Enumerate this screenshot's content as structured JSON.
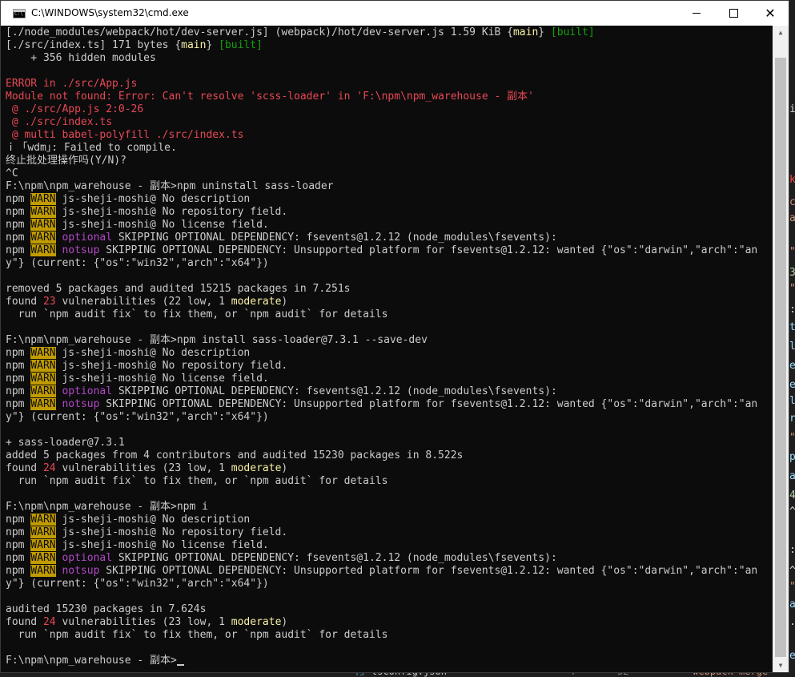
{
  "window": {
    "title": "C:\\WINDOWS\\system32\\cmd.exe",
    "minimize": "minimize",
    "maximize": "maximize",
    "close": "✕"
  },
  "background": {
    "right_chars": [
      "i",
      "k",
      "c",
      "a",
      "\"",
      "3",
      "\"",
      ":",
      "t",
      "l",
      "e",
      "e",
      "l",
      "r",
      "\"",
      "p",
      "a",
      "4",
      "^",
      ":",
      "^",
      "\"",
      "a",
      ".",
      "e"
    ],
    "bottom_ts": "TS",
    "bottom_file": "tsconfig.json",
    "bottom_num1": "7",
    "bottom_num2": "32",
    "bottom_code": "\"webpack-merge\""
  },
  "console_lines": [
    [
      {
        "t": "[./node_modules/webpack/hot/dev-server.js] (webpack)/hot/dev-server.js 1.59 KiB {"
      },
      {
        "t": "main",
        "c": "yellow"
      },
      {
        "t": "} "
      },
      {
        "t": "[built]",
        "c": "green"
      }
    ],
    [
      {
        "t": "[./src/index.ts] 171 bytes {"
      },
      {
        "t": "main",
        "c": "yellow"
      },
      {
        "t": "} "
      },
      {
        "t": "[built]",
        "c": "green"
      }
    ],
    [
      {
        "t": "    + 356 hidden modules"
      }
    ],
    [
      {
        "t": ""
      }
    ],
    [
      {
        "t": "ERROR in ./src/App.js",
        "c": "red"
      }
    ],
    [
      {
        "t": "Module not found: Error: Can't resolve 'scss-loader' in 'F:\\npm\\npm_warehouse - 副本'",
        "c": "red"
      }
    ],
    [
      {
        "t": " @ ./src/App.js 2:0-26",
        "c": "red"
      }
    ],
    [
      {
        "t": " @ ./src/index.ts",
        "c": "red"
      }
    ],
    [
      {
        "t": " @ multi babel-polyfill ./src/index.ts",
        "c": "red"
      }
    ],
    [
      {
        "t": "ｉ ｢wdm｣: Failed to compile."
      }
    ],
    [
      {
        "t": "终止批处理操作吗(Y/N)?"
      }
    ],
    [
      {
        "t": "^C"
      }
    ],
    [
      {
        "t": "F:\\npm\\npm_warehouse - 副本>npm uninstall sass-loader"
      }
    ],
    [
      {
        "t": "npm "
      },
      {
        "t": "WARN",
        "c": "warnbg"
      },
      {
        "t": " js-sheji-moshi@ No description"
      }
    ],
    [
      {
        "t": "npm "
      },
      {
        "t": "WARN",
        "c": "warnbg"
      },
      {
        "t": " js-sheji-moshi@ No repository field."
      }
    ],
    [
      {
        "t": "npm "
      },
      {
        "t": "WARN",
        "c": "warnbg"
      },
      {
        "t": " js-sheji-moshi@ No license field."
      }
    ],
    [
      {
        "t": "npm "
      },
      {
        "t": "WARN",
        "c": "warnbg"
      },
      {
        "t": " "
      },
      {
        "t": "optional",
        "c": "magenta"
      },
      {
        "t": " SKIPPING OPTIONAL DEPENDENCY: fsevents@1.2.12 (node_modules\\fsevents):"
      }
    ],
    [
      {
        "t": "npm "
      },
      {
        "t": "WARN",
        "c": "warnbg"
      },
      {
        "t": " "
      },
      {
        "t": "notsup",
        "c": "magenta"
      },
      {
        "t": " SKIPPING OPTIONAL DEPENDENCY: Unsupported platform for fsevents@1.2.12: wanted {\"os\":\"darwin\",\"arch\":\"an"
      }
    ],
    [
      {
        "t": "y\"} (current: {\"os\":\"win32\",\"arch\":\"x64\"})"
      }
    ],
    [
      {
        "t": ""
      }
    ],
    [
      {
        "t": "removed 5 packages and audited 15215 packages in 7.251s"
      }
    ],
    [
      {
        "t": "found "
      },
      {
        "t": "23",
        "c": "red"
      },
      {
        "t": " vulnerabilities (22 low, 1 "
      },
      {
        "t": "moderate",
        "c": "yellow"
      },
      {
        "t": ")"
      }
    ],
    [
      {
        "t": "  run `npm audit fix` to fix them, or `npm audit` for details"
      }
    ],
    [
      {
        "t": ""
      }
    ],
    [
      {
        "t": "F:\\npm\\npm_warehouse - 副本>npm install sass-loader@7.3.1 --save-dev"
      }
    ],
    [
      {
        "t": "npm "
      },
      {
        "t": "WARN",
        "c": "warnbg"
      },
      {
        "t": " js-sheji-moshi@ No description"
      }
    ],
    [
      {
        "t": "npm "
      },
      {
        "t": "WARN",
        "c": "warnbg"
      },
      {
        "t": " js-sheji-moshi@ No repository field."
      }
    ],
    [
      {
        "t": "npm "
      },
      {
        "t": "WARN",
        "c": "warnbg"
      },
      {
        "t": " js-sheji-moshi@ No license field."
      }
    ],
    [
      {
        "t": "npm "
      },
      {
        "t": "WARN",
        "c": "warnbg"
      },
      {
        "t": " "
      },
      {
        "t": "optional",
        "c": "magenta"
      },
      {
        "t": " SKIPPING OPTIONAL DEPENDENCY: fsevents@1.2.12 (node_modules\\fsevents):"
      }
    ],
    [
      {
        "t": "npm "
      },
      {
        "t": "WARN",
        "c": "warnbg"
      },
      {
        "t": " "
      },
      {
        "t": "notsup",
        "c": "magenta"
      },
      {
        "t": " SKIPPING OPTIONAL DEPENDENCY: Unsupported platform for fsevents@1.2.12: wanted {\"os\":\"darwin\",\"arch\":\"an"
      }
    ],
    [
      {
        "t": "y\"} (current: {\"os\":\"win32\",\"arch\":\"x64\"})"
      }
    ],
    [
      {
        "t": ""
      }
    ],
    [
      {
        "t": "+ sass-loader@7.3.1"
      }
    ],
    [
      {
        "t": "added 5 packages from 4 contributors and audited 15230 packages in 8.522s"
      }
    ],
    [
      {
        "t": "found "
      },
      {
        "t": "24",
        "c": "red"
      },
      {
        "t": " vulnerabilities (23 low, 1 "
      },
      {
        "t": "moderate",
        "c": "yellow"
      },
      {
        "t": ")"
      }
    ],
    [
      {
        "t": "  run `npm audit fix` to fix them, or `npm audit` for details"
      }
    ],
    [
      {
        "t": ""
      }
    ],
    [
      {
        "t": "F:\\npm\\npm_warehouse - 副本>npm i"
      }
    ],
    [
      {
        "t": "npm "
      },
      {
        "t": "WARN",
        "c": "warnbg"
      },
      {
        "t": " js-sheji-moshi@ No description"
      }
    ],
    [
      {
        "t": "npm "
      },
      {
        "t": "WARN",
        "c": "warnbg"
      },
      {
        "t": " js-sheji-moshi@ No repository field."
      }
    ],
    [
      {
        "t": "npm "
      },
      {
        "t": "WARN",
        "c": "warnbg"
      },
      {
        "t": " js-sheji-moshi@ No license field."
      }
    ],
    [
      {
        "t": "npm "
      },
      {
        "t": "WARN",
        "c": "warnbg"
      },
      {
        "t": " "
      },
      {
        "t": "optional",
        "c": "magenta"
      },
      {
        "t": " SKIPPING OPTIONAL DEPENDENCY: fsevents@1.2.12 (node_modules\\fsevents):"
      }
    ],
    [
      {
        "t": "npm "
      },
      {
        "t": "WARN",
        "c": "warnbg"
      },
      {
        "t": " "
      },
      {
        "t": "notsup",
        "c": "magenta"
      },
      {
        "t": " SKIPPING OPTIONAL DEPENDENCY: Unsupported platform for fsevents@1.2.12: wanted {\"os\":\"darwin\",\"arch\":\"an"
      }
    ],
    [
      {
        "t": "y\"} (current: {\"os\":\"win32\",\"arch\":\"x64\"})"
      }
    ],
    [
      {
        "t": ""
      }
    ],
    [
      {
        "t": "audited 15230 packages in 7.624s"
      }
    ],
    [
      {
        "t": "found "
      },
      {
        "t": "24",
        "c": "red"
      },
      {
        "t": " vulnerabilities (23 low, 1 "
      },
      {
        "t": "moderate",
        "c": "yellow"
      },
      {
        "t": ")"
      }
    ],
    [
      {
        "t": "  run `npm audit fix` to fix them, or `npm audit` for details"
      }
    ],
    [
      {
        "t": ""
      }
    ],
    [
      {
        "t": "F:\\npm\\npm_warehouse - 副本>"
      }
    ]
  ],
  "colors": {
    "console_bg": "#0c0c0c",
    "console_text": "#cccccc",
    "error_red": "#e74856",
    "built_green": "#13a10e",
    "warn_bg": "#c19c00",
    "tag_magenta": "#b148c6"
  }
}
